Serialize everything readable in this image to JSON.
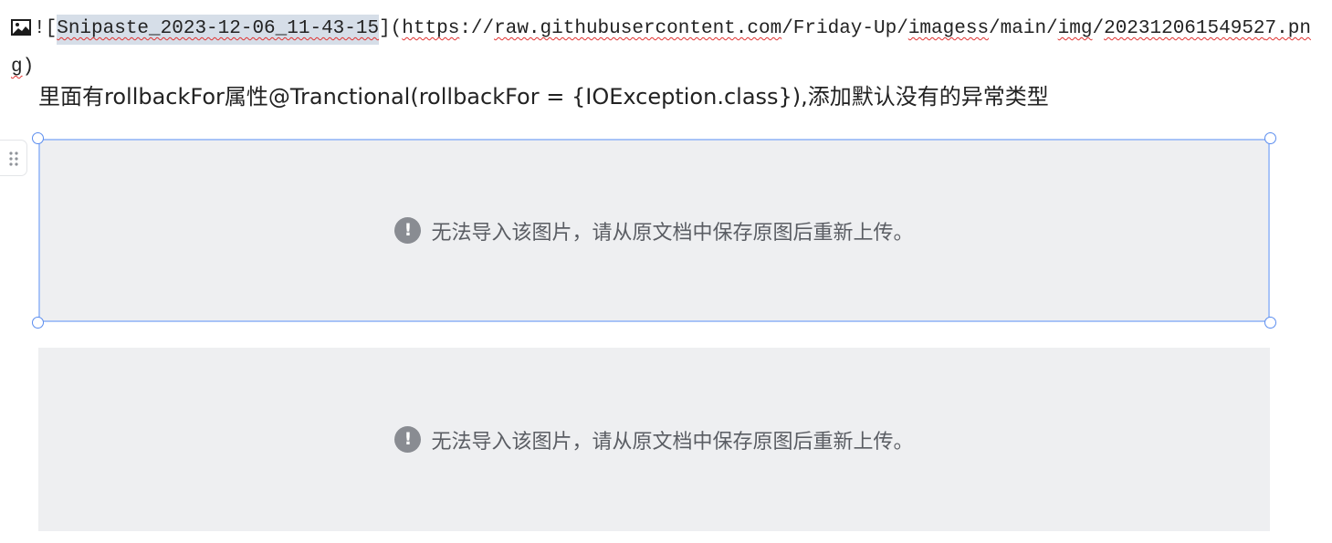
{
  "markdown": {
    "open": "![",
    "alt": "Snipaste_2023-12-06_11-43-15",
    "mid": "](",
    "url_https": "https",
    "url_sep1": "://",
    "url_host": "raw.githubusercontent.com",
    "url_sep2": "/",
    "url_user": "Friday-Up",
    "url_sep3": "/",
    "url_repo": "imagess",
    "url_path1": "/main/",
    "url_img": "img",
    "url_sep4": "/",
    "url_file_a": "20231206154952",
    "url_file_b": "7.png",
    "close": ")"
  },
  "paragraph": {
    "text": "里面有rollbackFor属性@Tranctional(rollbackFor = {IOException.class}),添加默认没有的异常类型"
  },
  "image_blocks": [
    {
      "icon": "!",
      "message": "无法导入该图片，请从原文档中保存原图后重新上传。",
      "selected": true
    },
    {
      "icon": "!",
      "message": "无法导入该图片，请从原文档中保存原图后重新上传。",
      "selected": false
    }
  ],
  "colors": {
    "selection_border": "#a8c3f7",
    "handle_border": "#5b8def",
    "placeholder_bg": "#eeeff1",
    "spellcheck_underline": "#e0312f"
  }
}
